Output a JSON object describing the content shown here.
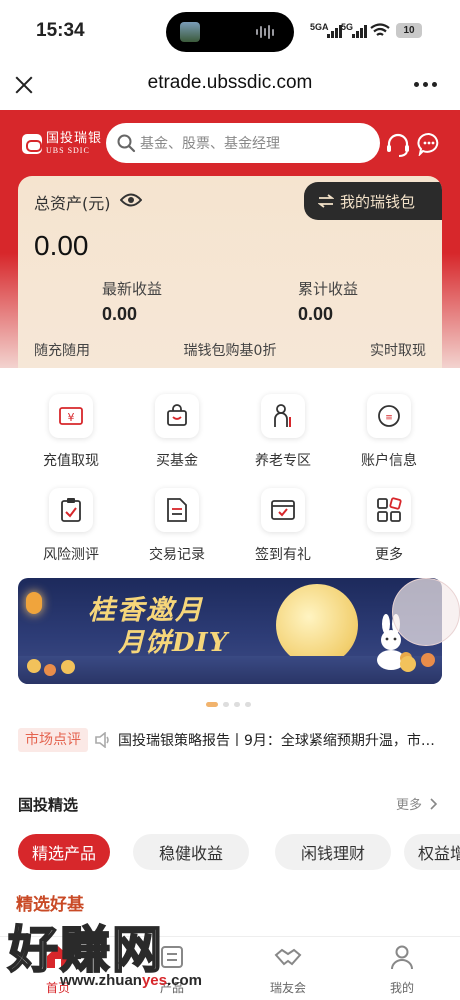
{
  "status_bar": {
    "time": "15:34",
    "signal1": "5GA",
    "signal2": "5G",
    "battery": "10"
  },
  "browser": {
    "url": "etrade.ubssdic.com"
  },
  "header": {
    "logo_cn": "国投瑞银",
    "logo_en": "UBS SDIC",
    "search_placeholder": "基金、股票、基金经理"
  },
  "asset_card": {
    "label": "总资产(元)",
    "wallet_button": "我的瑞钱包",
    "total_value": "0.00",
    "latest_income_label": "最新收益",
    "latest_income_value": "0.00",
    "cumulative_income_label": "累计收益",
    "cumulative_income_value": "0.00",
    "features": [
      "随充随用",
      "瑞钱包购基0折",
      "实时取现"
    ]
  },
  "quick_menu": [
    {
      "label": "充值取现",
      "icon": "recharge-icon"
    },
    {
      "label": "买基金",
      "icon": "shopping-bag-icon"
    },
    {
      "label": "养老专区",
      "icon": "elder-icon"
    },
    {
      "label": "账户信息",
      "icon": "account-icon"
    },
    {
      "label": "风险测评",
      "icon": "clipboard-check-icon"
    },
    {
      "label": "交易记录",
      "icon": "document-icon"
    },
    {
      "label": "签到有礼",
      "icon": "calendar-check-icon"
    },
    {
      "label": "更多",
      "icon": "grid-icon"
    }
  ],
  "banner": {
    "title_line1": "桂香邀月",
    "title_line2": "月饼DIY"
  },
  "news": {
    "tag": "市场点评",
    "text": "国投瑞银策略报告丨9月：全球紧缩预期升温，市场..."
  },
  "picks": {
    "title": "国投精选",
    "more": "更多",
    "tabs": [
      "精选产品",
      "稳健收益",
      "闲钱理财",
      "权益增"
    ],
    "subheading": "精选好基"
  },
  "tabbar": {
    "items": [
      {
        "label": "首页",
        "icon": "home-icon",
        "active": true
      },
      {
        "label": "产品",
        "icon": "product-icon",
        "active": false
      },
      {
        "label": "瑞友会",
        "icon": "handshake-icon",
        "active": false
      },
      {
        "label": "我的",
        "icon": "user-icon",
        "active": false
      }
    ]
  },
  "watermark": {
    "brand": "好赚网",
    "url_prefix": "www.zhuan",
    "url_highlight": "yes",
    "url_suffix": ".com"
  },
  "colors": {
    "brand_red": "#d7272b",
    "card_bg": "#f5e4cf",
    "wallet_btn": "#2b2b2b",
    "accent_orange": "#f1b36d"
  }
}
